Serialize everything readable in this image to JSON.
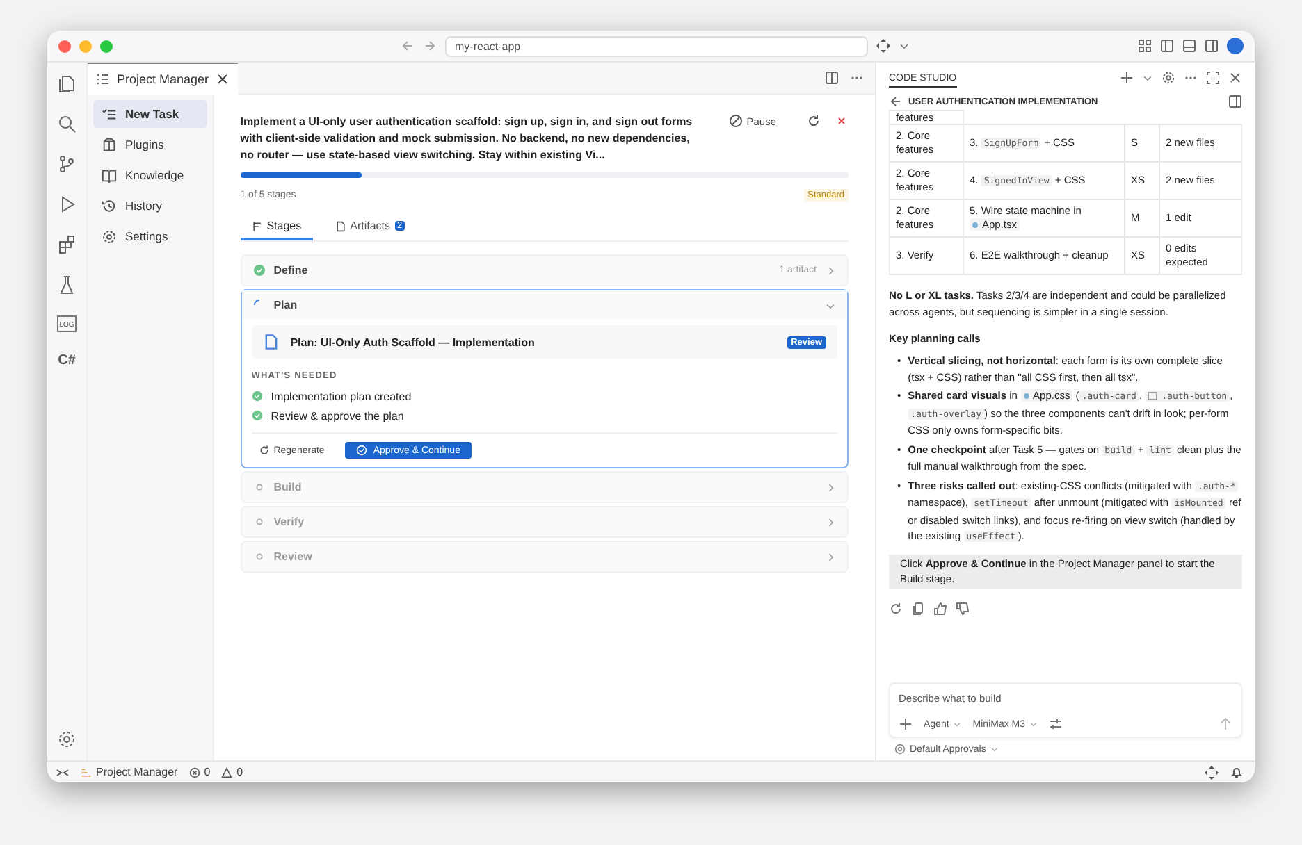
{
  "window": {
    "address": "my-react-app"
  },
  "activity_bar": {
    "log_label": "LOG",
    "csharp_label": "C#"
  },
  "editor_tab": {
    "title": "Project Manager"
  },
  "nav": [
    {
      "label": "New Task",
      "selected": true
    },
    {
      "label": "Plugins",
      "selected": false
    },
    {
      "label": "Knowledge",
      "selected": false
    },
    {
      "label": "History",
      "selected": false
    },
    {
      "label": "Settings",
      "selected": false
    }
  ],
  "task": {
    "title": "Implement a UI-only user authentication scaffold: sign up, sign in, and sign out forms with client-side validation and mock submission. No backend, no new dependencies, no router — use state-based view switching. Stay within existing Vi...",
    "pause": "Pause",
    "level": 0.2,
    "progress_text": "1 of 5 stages",
    "tier": "Standard"
  },
  "tabs": [
    {
      "label": "Stages",
      "selected": true
    },
    {
      "label": "Artifacts",
      "selected": false,
      "badge": "2"
    }
  ],
  "stages": [
    {
      "name": "Define",
      "kind": "done",
      "expanded": false,
      "meta": "1 artifact"
    },
    {
      "name": "Plan",
      "kind": "active",
      "expanded": true
    },
    {
      "name": "Build",
      "kind": "pending",
      "expanded": false
    },
    {
      "name": "Verify",
      "kind": "pending",
      "expanded": false
    },
    {
      "name": "Review",
      "kind": "pending",
      "expanded": false
    }
  ],
  "plan_detail": {
    "artifact": "Plan: UI-Only Auth Scaffold — Implementation",
    "badge": "Review",
    "needed_heading": "WHAT'S NEEDED",
    "needed": [
      {
        "text": "Implementation plan created",
        "done": true
      },
      {
        "text": "Review & approve the plan",
        "done": true
      }
    ],
    "regenerate": "Regenerate",
    "approve": "Approve & Continue"
  },
  "right_panel": {
    "tab": "CODE STUDIO",
    "title": "USER AUTHENTICATION IMPLEMENTATION",
    "table": {
      "rows": [
        {
          "cells": [
            [
              {
                "kind": "text",
                "t": "features"
              }
            ]
          ]
        },
        {
          "cells": [
            [
              {
                "kind": "text",
                "t": "2. Core features"
              }
            ],
            [
              {
                "kind": "text",
                "t": "3. "
              },
              {
                "kind": "code",
                "t": "SignUpForm"
              },
              {
                "kind": "text",
                "t": " + CSS"
              }
            ],
            [
              {
                "kind": "text",
                "t": "S"
              }
            ],
            [
              {
                "kind": "text",
                "t": "2 new files"
              }
            ]
          ]
        },
        {
          "cells": [
            [
              {
                "kind": "text",
                "t": "2. Core features"
              }
            ],
            [
              {
                "kind": "text",
                "t": "4. "
              },
              {
                "kind": "code",
                "t": "SignedInView"
              },
              {
                "kind": "text",
                "t": " + CSS"
              }
            ],
            [
              {
                "kind": "text",
                "t": "XS"
              }
            ],
            [
              {
                "kind": "text",
                "t": "2 new files"
              }
            ]
          ]
        },
        {
          "cells": [
            [
              {
                "kind": "text",
                "t": "2. Core features"
              }
            ],
            [
              {
                "kind": "text",
                "t": "5. Wire state machine in "
              },
              {
                "kind": "file",
                "t": "App.tsx"
              }
            ],
            [
              {
                "kind": "text",
                "t": "M"
              }
            ],
            [
              {
                "kind": "text",
                "t": "1 edit"
              }
            ]
          ]
        },
        {
          "cells": [
            [
              {
                "kind": "text",
                "t": "3. Verify"
              }
            ],
            [
              {
                "kind": "text",
                "t": "6. E2E walkthrough + cleanup"
              }
            ],
            [
              {
                "kind": "text",
                "t": "XS"
              }
            ],
            [
              {
                "kind": "text",
                "t": "0 edits expected"
              }
            ]
          ]
        }
      ]
    },
    "paragraph": [
      {
        "kind": "bold",
        "t": "No L or XL tasks."
      },
      {
        "kind": "text",
        "t": " Tasks 2/3/4 are independent and could be parallelized across agents, but sequencing is simpler in a single session."
      }
    ],
    "heading": "Key planning calls",
    "bullets": [
      {
        "marker": "•",
        "segs": [
          {
            "kind": "bold",
            "t": "Vertical slicing, not horizontal"
          },
          {
            "kind": "text",
            "t": ": each form is its own complete slice (tsx + CSS) rather than \"all CSS first, then all tsx\"."
          }
        ]
      },
      {
        "marker": "•",
        "segs": [
          {
            "kind": "bold",
            "t": "Shared card visuals"
          },
          {
            "kind": "text",
            "t": " in "
          },
          {
            "kind": "file",
            "t": "App.css"
          },
          {
            "kind": "text",
            "t": " ("
          },
          {
            "kind": "code",
            "t": ".auth-card"
          },
          {
            "kind": "text",
            "t": ", "
          },
          {
            "kind": "tag",
            "t": ".auth-button"
          },
          {
            "kind": "text",
            "t": ", "
          },
          {
            "kind": "code",
            "t": ".auth-overlay"
          },
          {
            "kind": "text",
            "t": ") so the three components can't drift in look; per-form CSS only owns form-specific bits."
          }
        ]
      },
      {
        "marker": "•",
        "segs": [
          {
            "kind": "bold",
            "t": "One checkpoint"
          },
          {
            "kind": "text",
            "t": " after Task 5 — gates on "
          },
          {
            "kind": "code",
            "t": "build"
          },
          {
            "kind": "text",
            "t": " + "
          },
          {
            "kind": "code",
            "t": "lint"
          },
          {
            "kind": "text",
            "t": " clean plus the full manual walkthrough from the spec."
          }
        ]
      },
      {
        "marker": "•",
        "segs": [
          {
            "kind": "bold",
            "t": "Three risks called out"
          },
          {
            "kind": "text",
            "t": ": existing-CSS conflicts (mitigated with "
          },
          {
            "kind": "code",
            "t": ".auth-*"
          },
          {
            "kind": "text",
            "t": " namespace), "
          },
          {
            "kind": "code",
            "t": "setTimeout"
          },
          {
            "kind": "text",
            "t": " after unmount (mitigated with "
          },
          {
            "kind": "code",
            "t": "isMounted"
          },
          {
            "kind": "text",
            "t": " ref or disabled switch links), and focus re-firing on view switch (handled by the existing "
          },
          {
            "kind": "code",
            "t": "useEffect"
          },
          {
            "kind": "text",
            "t": ")."
          }
        ]
      }
    ],
    "callout": [
      {
        "kind": "text",
        "t": "Click "
      },
      {
        "kind": "bold",
        "t": "Approve & Continue"
      },
      {
        "kind": "text",
        "t": " in the Project Manager panel to start the Build stage."
      }
    ],
    "composer": {
      "placeholder": "Describe what to build",
      "mode": "Agent",
      "model": "MiniMax M3"
    },
    "approvals": "Default Approvals"
  },
  "status_bar": {
    "panel": "Project Manager",
    "errors": "0",
    "warnings": "0"
  }
}
